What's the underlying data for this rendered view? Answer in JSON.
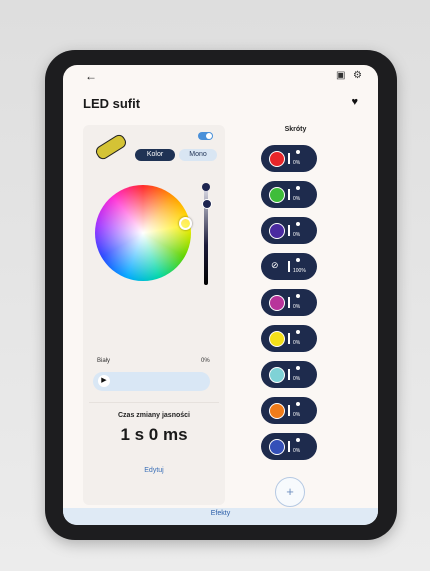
{
  "header": {
    "back_icon": "arrow-left-icon",
    "title": "LED sufit",
    "icons": [
      "image-icon",
      "settings-icon"
    ],
    "favorite_icon": "heart-icon"
  },
  "control": {
    "power_on": true,
    "modes": {
      "color": "Kolor",
      "mono": "Mono",
      "selected": "Kolor"
    },
    "white_label": "Biały",
    "white_value": "0%",
    "transition_label": "Czas zmiany jasności",
    "transition_value": "1 s 0 ms",
    "edit_label": "Edytuj"
  },
  "shortcuts": {
    "title": "Skróty",
    "items": [
      {
        "color": "#e8262a",
        "value": "0%",
        "type": "color"
      },
      {
        "color": "#3fbd3a",
        "value": "0%",
        "type": "color"
      },
      {
        "color": "#4a2aa0",
        "value": "0%",
        "type": "color"
      },
      {
        "color": "",
        "value": "100%",
        "type": "off"
      },
      {
        "color": "#b8349b",
        "value": "0%",
        "type": "color"
      },
      {
        "color": "#f4e01a",
        "value": "0%",
        "type": "color"
      },
      {
        "color": "#7fd2d6",
        "value": "0%",
        "type": "color"
      },
      {
        "color": "#f07c1a",
        "value": "0%",
        "type": "color"
      },
      {
        "color": "#3450b8",
        "value": "0%",
        "type": "color"
      }
    ],
    "add_label": "+"
  },
  "bottom": {
    "label": "Efekty"
  }
}
